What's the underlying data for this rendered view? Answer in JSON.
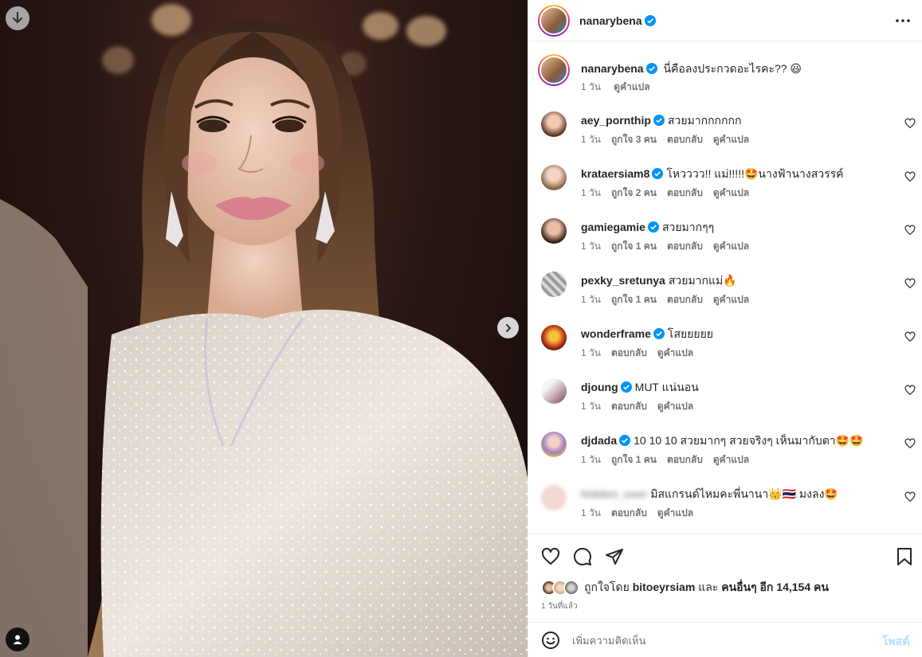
{
  "post": {
    "author": "nanarybena",
    "verified": true,
    "caption": {
      "text": "นี่คือลงประกวดอะไรคะ?? 😃",
      "time": "1 วัน",
      "translate": "ดูคำแปล"
    }
  },
  "photo": {
    "download_icon": "arrow-down-icon",
    "next_icon": "chevron-right-icon",
    "tag_icon": "user-tag-icon"
  },
  "comments": [
    {
      "user": "aey_pornthip",
      "verified": true,
      "text": "สวยมากกกกกก",
      "time": "1 วัน",
      "likes": "ถูกใจ 3 คน",
      "reply": "ตอบกลับ",
      "translate": "ดูคำแปล"
    },
    {
      "user": "krataersiam8",
      "verified": true,
      "text": "โหวววว!! แม่!!!!!🤩นางฟ้านางสวรรค์",
      "time": "1 วัน",
      "likes": "ถูกใจ 2 คน",
      "reply": "ตอบกลับ",
      "translate": "ดูคำแปล"
    },
    {
      "user": "gamiegamie",
      "verified": true,
      "text": "สวยมากๆๆ",
      "time": "1 วัน",
      "likes": "ถูกใจ 1 คน",
      "reply": "ตอบกลับ",
      "translate": "ดูคำแปล"
    },
    {
      "user": "pexky_sretunya",
      "verified": false,
      "text": "สวยมากแม่🔥",
      "time": "1 วัน",
      "likes": "ถูกใจ 1 คน",
      "reply": "ตอบกลับ",
      "translate": "ดูคำแปล"
    },
    {
      "user": "wonderframe",
      "verified": true,
      "text": "โสยยยยย",
      "time": "1 วัน",
      "likes": "",
      "reply": "ตอบกลับ",
      "translate": "ดูคำแปล"
    },
    {
      "user": "djoung",
      "verified": true,
      "text": "MUT แน่นอน",
      "time": "1 วัน",
      "likes": "",
      "reply": "ตอบกลับ",
      "translate": "ดูคำแปล"
    },
    {
      "user": "djdada",
      "verified": true,
      "text": "10 10 10 สวยมากๆ สวยจริงๆ เห็นมากับตา🤩🤩",
      "time": "1 วัน",
      "likes": "ถูกใจ 1 คน",
      "reply": "ตอบกลับ",
      "translate": "ดูคำแปล"
    },
    {
      "user": "hidden_user",
      "verified": false,
      "text": "มิสแกรนด์ไหมคะพี่นานา👑🇹🇭 มงลง🤩",
      "time": "1 วัน",
      "likes": "",
      "reply": "ตอบกลับ",
      "translate": "ดูคำแปล"
    }
  ],
  "actions": {
    "icons": [
      "heart-icon",
      "comment-icon",
      "share-icon",
      "bookmark-icon"
    ],
    "liked_by_prefix": "ถูกใจโดย",
    "liked_by_user": "bitoeyrsiam",
    "liked_by_and": "และ",
    "liked_by_others": "คนอื่นๆ อีก 14,154 คน",
    "posted": "1 วันที่แล้ว"
  },
  "comment_box": {
    "placeholder": "เพิ่มความคิดเห็น",
    "post_label": "โพสต์"
  },
  "colors": {
    "verified": "#0095f6",
    "post_disabled": "#b2dffc",
    "muted": "#737373"
  }
}
